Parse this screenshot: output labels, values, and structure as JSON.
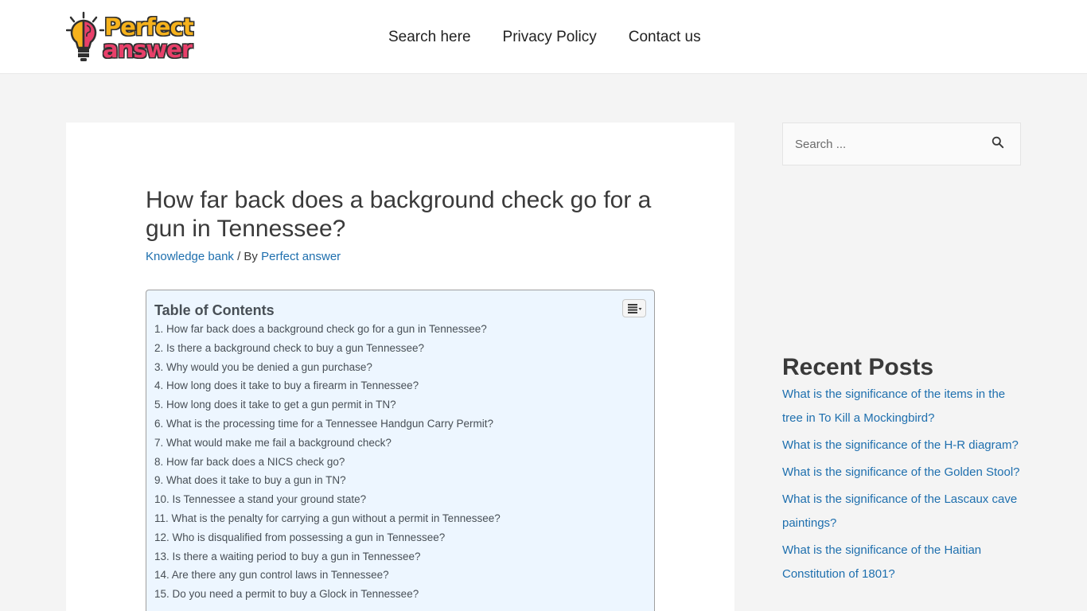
{
  "header": {
    "logo": {
      "line1": "Perfect",
      "line2": "answer"
    },
    "nav": [
      {
        "label": "Search here"
      },
      {
        "label": "Privacy Policy"
      },
      {
        "label": "Contact us"
      }
    ]
  },
  "article": {
    "title": "How far back does a background check go for a gun in Tennessee?",
    "meta": {
      "category": "Knowledge bank",
      "by_prefix": " / By ",
      "author": "Perfect answer"
    },
    "toc": {
      "title": "Table of Contents",
      "items": [
        "1. How far back does a background check go for a gun in Tennessee?",
        "2. Is there a background check to buy a gun Tennessee?",
        "3. Why would you be denied a gun purchase?",
        "4. How long does it take to buy a firearm in Tennessee?",
        "5. How long does it take to get a gun permit in TN?",
        "6. What is the processing time for a Tennessee Handgun Carry Permit?",
        "7. What would make me fail a background check?",
        "8. How far back does a NICS check go?",
        "9. What does it take to buy a gun in TN?",
        "10. Is Tennessee a stand your ground state?",
        "11. What is the penalty for carrying a gun without a permit in Tennessee?",
        "12. Who is disqualified from possessing a gun in Tennessee?",
        "13. Is there a waiting period to buy a gun in Tennessee?",
        "14. Are there any gun control laws in Tennessee?",
        "15. Do you need a permit to buy a Glock in Tennessee?"
      ]
    }
  },
  "sidebar": {
    "search": {
      "placeholder": "Search ..."
    },
    "recent_posts": {
      "title": "Recent Posts",
      "items": [
        "What is the significance of the items in the tree in To Kill a Mockingbird?",
        "What is the significance of the H-R diagram?",
        "What is the significance of the Golden Stool?",
        "What is the significance of the Lascaux cave paintings?",
        "What is the significance of the Haitian Constitution of 1801?"
      ]
    }
  },
  "colors": {
    "link": "#1e6fae",
    "toc_bg": "#edf6ff",
    "logo_yellow": "#f6b21c",
    "logo_pink": "#e8406a"
  }
}
